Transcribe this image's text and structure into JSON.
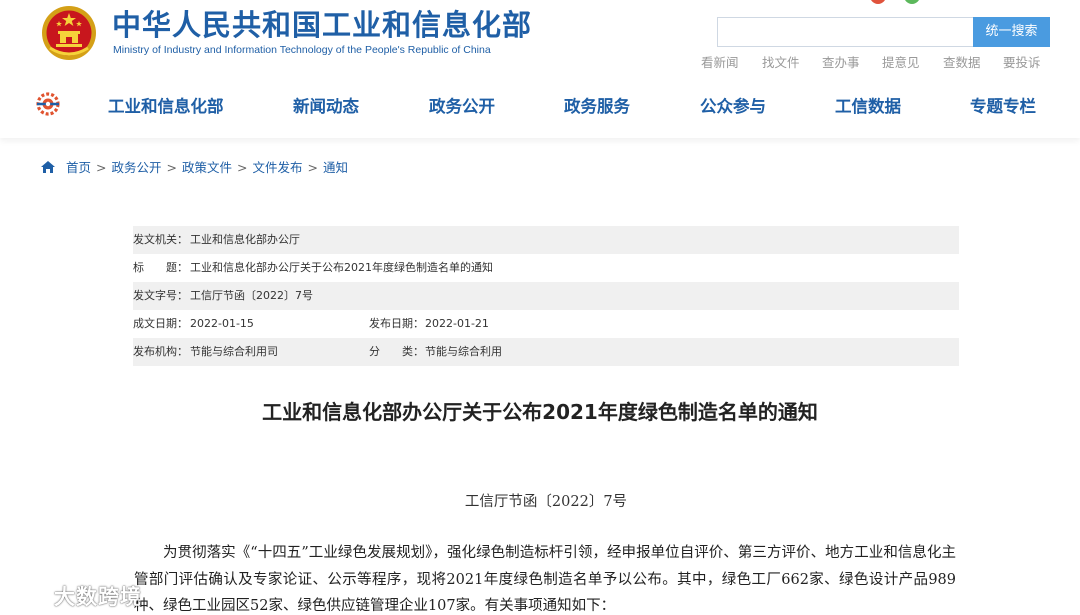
{
  "header": {
    "site_title": "中华人民共和国工业和信息化部",
    "site_subtitle": "Ministry of Industry and Information Technology of the People's Republic of China",
    "emblem_icon": "national-emblem-icon",
    "top_icons": [
      {
        "name": "weibo-icon",
        "color": "#e0533c"
      },
      {
        "name": "wechat-icon",
        "color": "#5cb85c"
      }
    ],
    "search": {
      "placeholder": "",
      "value": "",
      "button_label": "统一搜索",
      "button_color": "#4a9be0"
    },
    "quick_links": [
      "看新闻",
      "找文件",
      "查办事",
      "提意见",
      "查数据",
      "要投诉"
    ],
    "nav": {
      "logo_icon": "miit-logo-icon",
      "items": [
        "工业和信息化部",
        "新闻动态",
        "政务公开",
        "政务服务",
        "公众参与",
        "工信数据",
        "专题专栏"
      ]
    },
    "brand_color": "#1f5fa6"
  },
  "breadcrumb": {
    "home_icon": "home-icon",
    "items": [
      "首页",
      "政务公开",
      "政策文件",
      "文件发布",
      "通知"
    ],
    "separator": ">"
  },
  "info": {
    "issuer_label": "发文机关：",
    "issuer": "工业和信息化部办公厅",
    "title_label": "标　　题：",
    "title": "工业和信息化部办公厅关于公布2021年度绿色制造名单的通知",
    "docno_label": "发文字号：",
    "docno": "工信厅节函〔2022〕7号",
    "created_label": "成文日期：",
    "created": "2022-01-15",
    "published_label": "发布日期：",
    "published": "2022-01-21",
    "org_label": "发布机构：",
    "org": "节能与综合利用司",
    "category_label": "分　　类：",
    "category": "节能与综合利用"
  },
  "article": {
    "title": "工业和信息化部办公厅关于公布2021年度绿色制造名单的通知",
    "doc_number": "工信厅节函〔2022〕7号",
    "paragraph": "为贯彻落实《“十四五”工业绿色发展规划》，强化绿色制造标杆引领，经申报单位自评价、第三方评价、地方工业和信息化主管部门评估确认及专家论证、公示等程序，现将2021年度绿色制造名单予以公布。其中，绿色工厂662家、绿色设计产品989种、绿色工业园区52家、绿色供应链管理企业107家。有关事项通知如下："
  },
  "watermark": {
    "text": "大数跨境",
    "icon": "bird-logo-icon"
  }
}
